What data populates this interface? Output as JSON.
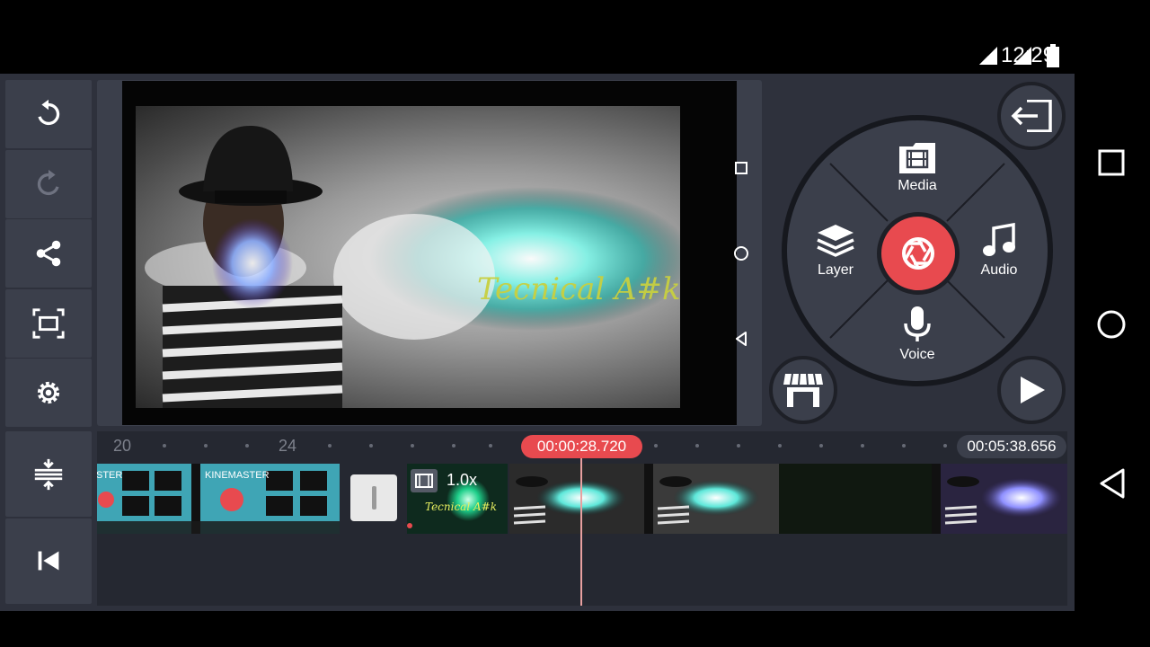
{
  "status_bar": {
    "time": "12:29",
    "icons": [
      "signal-icon",
      "wifi-icon",
      "battery-icon"
    ]
  },
  "left_toolbar": {
    "buttons": [
      "undo-icon",
      "redo-icon",
      "share-icon",
      "fullscreen-icon",
      "settings-icon"
    ],
    "bottom": [
      "expand-timeline-icon",
      "skip-to-start-icon"
    ]
  },
  "preview": {
    "watermark_text": "Tecnical A#k"
  },
  "media_wheel": {
    "media_label": "Media",
    "layer_label": "Layer",
    "audio_label": "Audio",
    "voice_label": "Voice"
  },
  "timeline": {
    "ruler_labels": [
      "20",
      "24"
    ],
    "playhead_time": "00:00:28.720",
    "total_time": "00:05:38.656",
    "clip_kinemaster_a": "STER",
    "clip_kinemaster_b": "KINEMASTER",
    "clip_speed": "1.0x"
  },
  "colors": {
    "accent": "#e84a4f",
    "panel": "#3b3f4b",
    "background": "#2e313c",
    "timeline": "#252831"
  }
}
